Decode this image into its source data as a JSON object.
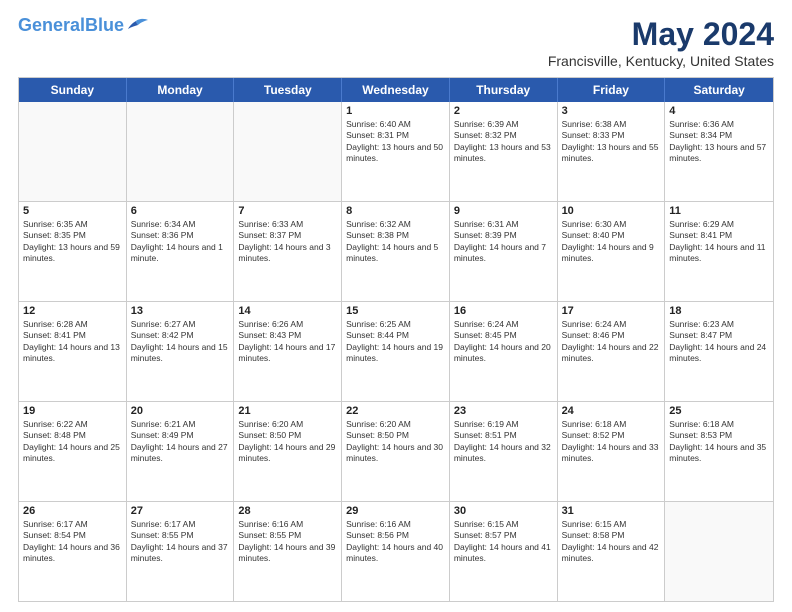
{
  "header": {
    "logo_line1": "General",
    "logo_line2": "Blue",
    "month": "May 2024",
    "location": "Francisville, Kentucky, United States"
  },
  "days_of_week": [
    "Sunday",
    "Monday",
    "Tuesday",
    "Wednesday",
    "Thursday",
    "Friday",
    "Saturday"
  ],
  "weeks": [
    [
      {
        "day": "",
        "sunrise": "",
        "sunset": "",
        "daylight": "",
        "empty": true
      },
      {
        "day": "",
        "sunrise": "",
        "sunset": "",
        "daylight": "",
        "empty": true
      },
      {
        "day": "",
        "sunrise": "",
        "sunset": "",
        "daylight": "",
        "empty": true
      },
      {
        "day": "1",
        "sunrise": "Sunrise: 6:40 AM",
        "sunset": "Sunset: 8:31 PM",
        "daylight": "Daylight: 13 hours and 50 minutes.",
        "empty": false
      },
      {
        "day": "2",
        "sunrise": "Sunrise: 6:39 AM",
        "sunset": "Sunset: 8:32 PM",
        "daylight": "Daylight: 13 hours and 53 minutes.",
        "empty": false
      },
      {
        "day": "3",
        "sunrise": "Sunrise: 6:38 AM",
        "sunset": "Sunset: 8:33 PM",
        "daylight": "Daylight: 13 hours and 55 minutes.",
        "empty": false
      },
      {
        "day": "4",
        "sunrise": "Sunrise: 6:36 AM",
        "sunset": "Sunset: 8:34 PM",
        "daylight": "Daylight: 13 hours and 57 minutes.",
        "empty": false
      }
    ],
    [
      {
        "day": "5",
        "sunrise": "Sunrise: 6:35 AM",
        "sunset": "Sunset: 8:35 PM",
        "daylight": "Daylight: 13 hours and 59 minutes.",
        "empty": false
      },
      {
        "day": "6",
        "sunrise": "Sunrise: 6:34 AM",
        "sunset": "Sunset: 8:36 PM",
        "daylight": "Daylight: 14 hours and 1 minute.",
        "empty": false
      },
      {
        "day": "7",
        "sunrise": "Sunrise: 6:33 AM",
        "sunset": "Sunset: 8:37 PM",
        "daylight": "Daylight: 14 hours and 3 minutes.",
        "empty": false
      },
      {
        "day": "8",
        "sunrise": "Sunrise: 6:32 AM",
        "sunset": "Sunset: 8:38 PM",
        "daylight": "Daylight: 14 hours and 5 minutes.",
        "empty": false
      },
      {
        "day": "9",
        "sunrise": "Sunrise: 6:31 AM",
        "sunset": "Sunset: 8:39 PM",
        "daylight": "Daylight: 14 hours and 7 minutes.",
        "empty": false
      },
      {
        "day": "10",
        "sunrise": "Sunrise: 6:30 AM",
        "sunset": "Sunset: 8:40 PM",
        "daylight": "Daylight: 14 hours and 9 minutes.",
        "empty": false
      },
      {
        "day": "11",
        "sunrise": "Sunrise: 6:29 AM",
        "sunset": "Sunset: 8:41 PM",
        "daylight": "Daylight: 14 hours and 11 minutes.",
        "empty": false
      }
    ],
    [
      {
        "day": "12",
        "sunrise": "Sunrise: 6:28 AM",
        "sunset": "Sunset: 8:41 PM",
        "daylight": "Daylight: 14 hours and 13 minutes.",
        "empty": false
      },
      {
        "day": "13",
        "sunrise": "Sunrise: 6:27 AM",
        "sunset": "Sunset: 8:42 PM",
        "daylight": "Daylight: 14 hours and 15 minutes.",
        "empty": false
      },
      {
        "day": "14",
        "sunrise": "Sunrise: 6:26 AM",
        "sunset": "Sunset: 8:43 PM",
        "daylight": "Daylight: 14 hours and 17 minutes.",
        "empty": false
      },
      {
        "day": "15",
        "sunrise": "Sunrise: 6:25 AM",
        "sunset": "Sunset: 8:44 PM",
        "daylight": "Daylight: 14 hours and 19 minutes.",
        "empty": false
      },
      {
        "day": "16",
        "sunrise": "Sunrise: 6:24 AM",
        "sunset": "Sunset: 8:45 PM",
        "daylight": "Daylight: 14 hours and 20 minutes.",
        "empty": false
      },
      {
        "day": "17",
        "sunrise": "Sunrise: 6:24 AM",
        "sunset": "Sunset: 8:46 PM",
        "daylight": "Daylight: 14 hours and 22 minutes.",
        "empty": false
      },
      {
        "day": "18",
        "sunrise": "Sunrise: 6:23 AM",
        "sunset": "Sunset: 8:47 PM",
        "daylight": "Daylight: 14 hours and 24 minutes.",
        "empty": false
      }
    ],
    [
      {
        "day": "19",
        "sunrise": "Sunrise: 6:22 AM",
        "sunset": "Sunset: 8:48 PM",
        "daylight": "Daylight: 14 hours and 25 minutes.",
        "empty": false
      },
      {
        "day": "20",
        "sunrise": "Sunrise: 6:21 AM",
        "sunset": "Sunset: 8:49 PM",
        "daylight": "Daylight: 14 hours and 27 minutes.",
        "empty": false
      },
      {
        "day": "21",
        "sunrise": "Sunrise: 6:20 AM",
        "sunset": "Sunset: 8:50 PM",
        "daylight": "Daylight: 14 hours and 29 minutes.",
        "empty": false
      },
      {
        "day": "22",
        "sunrise": "Sunrise: 6:20 AM",
        "sunset": "Sunset: 8:50 PM",
        "daylight": "Daylight: 14 hours and 30 minutes.",
        "empty": false
      },
      {
        "day": "23",
        "sunrise": "Sunrise: 6:19 AM",
        "sunset": "Sunset: 8:51 PM",
        "daylight": "Daylight: 14 hours and 32 minutes.",
        "empty": false
      },
      {
        "day": "24",
        "sunrise": "Sunrise: 6:18 AM",
        "sunset": "Sunset: 8:52 PM",
        "daylight": "Daylight: 14 hours and 33 minutes.",
        "empty": false
      },
      {
        "day": "25",
        "sunrise": "Sunrise: 6:18 AM",
        "sunset": "Sunset: 8:53 PM",
        "daylight": "Daylight: 14 hours and 35 minutes.",
        "empty": false
      }
    ],
    [
      {
        "day": "26",
        "sunrise": "Sunrise: 6:17 AM",
        "sunset": "Sunset: 8:54 PM",
        "daylight": "Daylight: 14 hours and 36 minutes.",
        "empty": false
      },
      {
        "day": "27",
        "sunrise": "Sunrise: 6:17 AM",
        "sunset": "Sunset: 8:55 PM",
        "daylight": "Daylight: 14 hours and 37 minutes.",
        "empty": false
      },
      {
        "day": "28",
        "sunrise": "Sunrise: 6:16 AM",
        "sunset": "Sunset: 8:55 PM",
        "daylight": "Daylight: 14 hours and 39 minutes.",
        "empty": false
      },
      {
        "day": "29",
        "sunrise": "Sunrise: 6:16 AM",
        "sunset": "Sunset: 8:56 PM",
        "daylight": "Daylight: 14 hours and 40 minutes.",
        "empty": false
      },
      {
        "day": "30",
        "sunrise": "Sunrise: 6:15 AM",
        "sunset": "Sunset: 8:57 PM",
        "daylight": "Daylight: 14 hours and 41 minutes.",
        "empty": false
      },
      {
        "day": "31",
        "sunrise": "Sunrise: 6:15 AM",
        "sunset": "Sunset: 8:58 PM",
        "daylight": "Daylight: 14 hours and 42 minutes.",
        "empty": false
      },
      {
        "day": "",
        "sunrise": "",
        "sunset": "",
        "daylight": "",
        "empty": true
      }
    ]
  ]
}
